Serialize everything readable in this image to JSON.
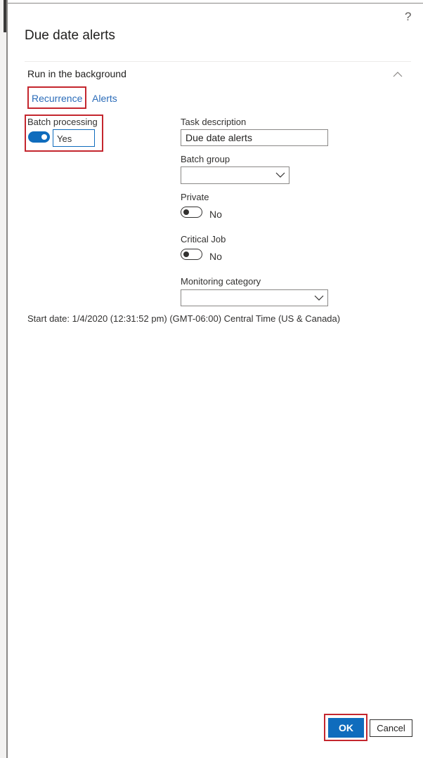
{
  "dialog": {
    "title": "Due date alerts",
    "help_icon": "?"
  },
  "section": {
    "title": "Run in the background",
    "collapse_icon": "chevron-up-icon"
  },
  "tabs": [
    {
      "label": "Recurrence"
    },
    {
      "label": "Alerts"
    }
  ],
  "fields": {
    "batch_processing": {
      "label": "Batch processing",
      "value": "Yes",
      "on": true
    },
    "task_description": {
      "label": "Task description",
      "value": "Due date alerts"
    },
    "batch_group": {
      "label": "Batch group",
      "value": ""
    },
    "private": {
      "label": "Private",
      "value": "No",
      "on": false
    },
    "critical_job": {
      "label": "Critical Job",
      "value": "No",
      "on": false
    },
    "monitoring_category": {
      "label": "Monitoring category",
      "value": ""
    }
  },
  "start_date": "Start date: 1/4/2020 (12:31:52 pm) (GMT-06:00) Central Time (US & Canada)",
  "buttons": {
    "ok": "OK",
    "cancel": "Cancel"
  },
  "colors": {
    "accent": "#0f6cbd",
    "link": "#2b6cb9",
    "highlight_box": "#c4262e"
  }
}
